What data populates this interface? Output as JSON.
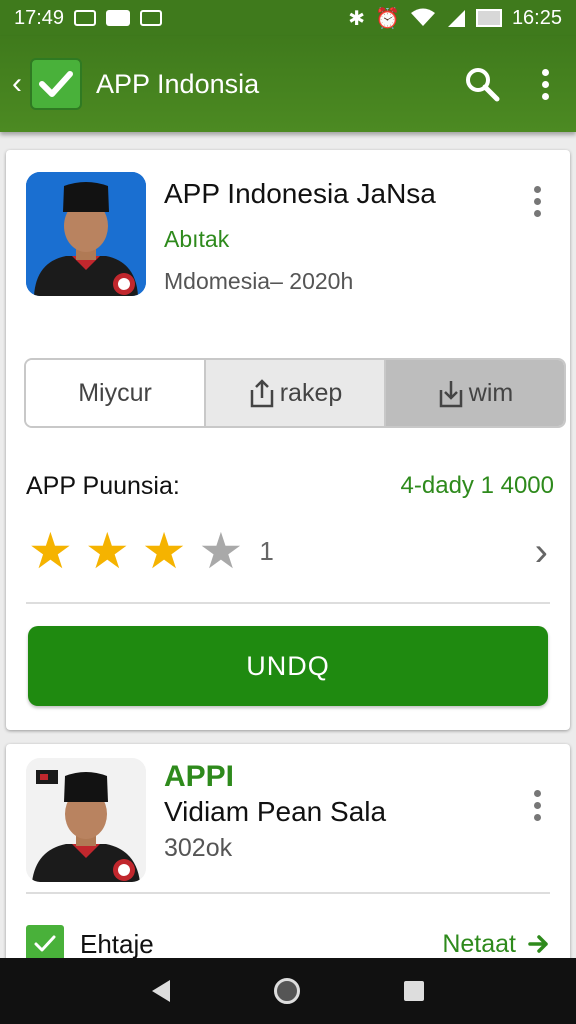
{
  "status_bar": {
    "time_left": "17:49",
    "time_right": "16:25"
  },
  "app_bar": {
    "title": "APP Indonsia",
    "icons": [
      "back-chevron-icon",
      "check-logo-icon",
      "search-icon",
      "more-vert-icon"
    ]
  },
  "app_card": {
    "title": "APP Indonesia JaNsa",
    "developer": "Abıtak",
    "meta": "Mdomesia– 2020h",
    "segments": [
      {
        "label": "Miycur",
        "icon": ""
      },
      {
        "label": "rakep",
        "icon": "share-upload-icon"
      },
      {
        "label": "wim",
        "icon": "download-icon"
      }
    ],
    "rating_label": "APP Puunsia:",
    "rating_count": "4-dady 1 4000",
    "stars": 3,
    "stars_max": 4,
    "star_number": "1",
    "install_label": "UNDQ",
    "colors": {
      "accent": "#1f8a10",
      "green_text": "#2e8a1c",
      "star": "#f5b300"
    }
  },
  "second_card": {
    "name": "APPI",
    "title": "Vidiam Pean Sala",
    "meta": "302ok",
    "row_label": "Ehtaje",
    "row_link": "Netaat"
  }
}
